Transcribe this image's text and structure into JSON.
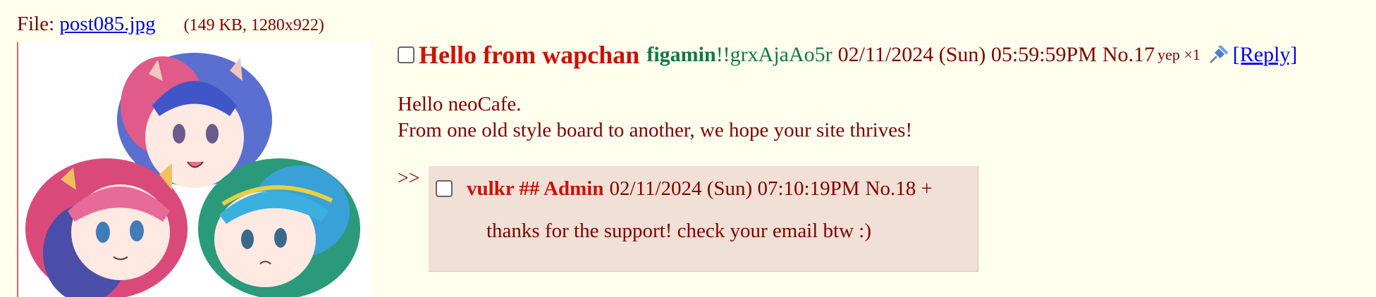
{
  "file": {
    "label": "File: ",
    "filename": "post085.jpg",
    "meta": "(149 KB, 1280x922)"
  },
  "op": {
    "subject": "Hello from wapchan",
    "name": "figamin",
    "tripcode": "!!grxAjaAo5r",
    "date": "02/11/2024 (Sun) 05:59:59PM",
    "post_number": "No.17",
    "reaction": "yep ×1",
    "pin_icon": "pushpin-icon",
    "reply_link": "[Reply]",
    "comment_lines": [
      "Hello neoCafe.",
      "From one old style board to another, we hope your site thrives!"
    ]
  },
  "reply": {
    "arrows": ">>",
    "name": "vulkr ## Admin",
    "date": "02/11/2024 (Sun) 07:10:19PM",
    "post_number": "No.18 +",
    "message": "thanks for the support! check your email btw :)"
  },
  "colors": {
    "background": "#ffffee",
    "text": "#800000",
    "subject": "#cc1105",
    "name": "#117743",
    "link": "#0000ee",
    "reply_background": "#f0e0d6"
  }
}
